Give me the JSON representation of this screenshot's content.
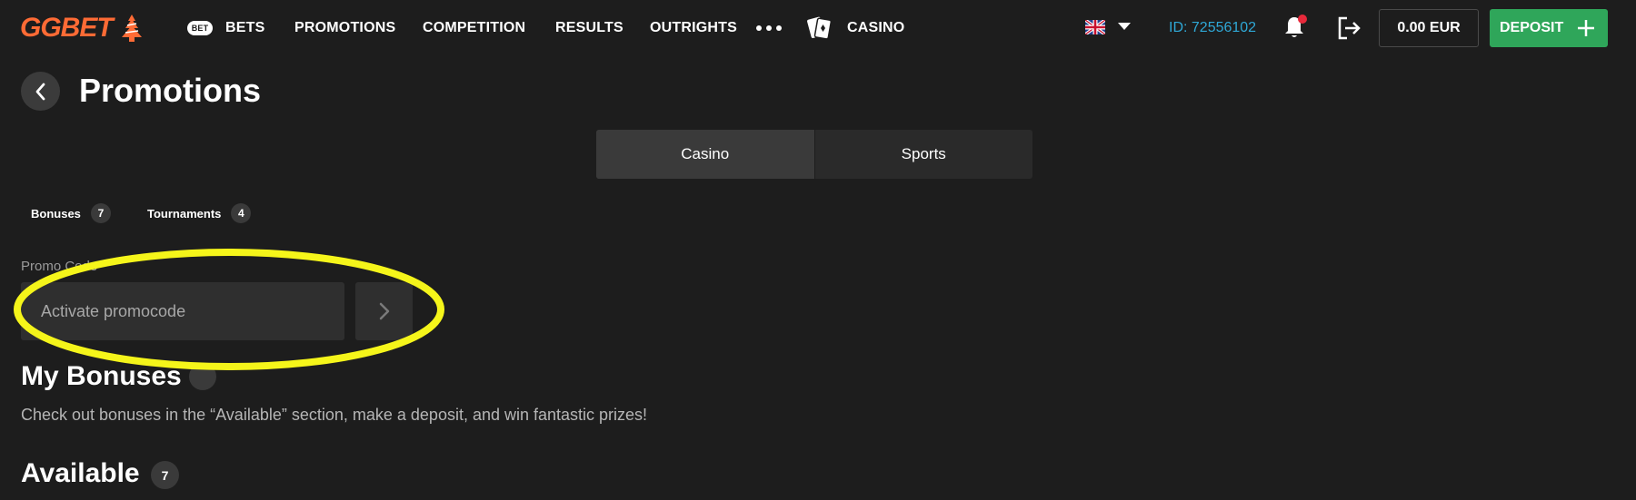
{
  "header": {
    "logo_text": "GGBET",
    "nav": {
      "bet_badge": "BET",
      "bets": "BETS",
      "promotions": "PROMOTIONS",
      "competition": "COMPETITION",
      "results": "RESULTS",
      "outrights": "OUTRIGHTS",
      "casino": "CASINO"
    },
    "language": "English (UK)",
    "user_id": "ID: 72556102",
    "balance": "0.00 EUR",
    "deposit_label": "DEPOSIT",
    "notification_dot_color": "#e8293b",
    "deposit_color": "#2fa65a",
    "accent_logo_color": "#ff6b35",
    "user_id_color": "#2fa8d6"
  },
  "page": {
    "title": "Promotions"
  },
  "tabs": [
    {
      "label": "Casino",
      "active": true
    },
    {
      "label": "Sports",
      "active": false
    }
  ],
  "filters": [
    {
      "label": "Bonuses",
      "count": "7"
    },
    {
      "label": "Tournaments",
      "count": "4"
    }
  ],
  "promo": {
    "label": "Promo Code",
    "placeholder": "Activate promocode",
    "highlight_color": "#f5f51a"
  },
  "my_bonuses": {
    "title": "My Bonuses",
    "description": "Check out bonuses in the “Available” section, make a deposit, and win fantastic prizes!"
  },
  "available": {
    "title": "Available",
    "count": "7"
  }
}
